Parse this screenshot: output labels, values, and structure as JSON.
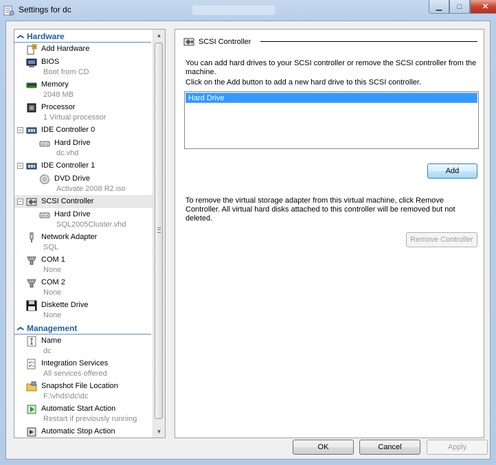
{
  "window": {
    "title": "Settings for dc",
    "close_glyph": "✕",
    "min_glyph": "▁",
    "max_glyph": "□"
  },
  "nav": {
    "sections": [
      {
        "title": "Hardware",
        "items": [
          {
            "key": "add-hardware",
            "label": "Add Hardware",
            "sub": "",
            "icon": "add-hardware-icon",
            "level": 0,
            "expander": ""
          },
          {
            "key": "bios",
            "label": "BIOS",
            "sub": "Boot from CD",
            "icon": "bios-icon",
            "level": 0,
            "expander": ""
          },
          {
            "key": "memory",
            "label": "Memory",
            "sub": "2048 MB",
            "icon": "memory-icon",
            "level": 0,
            "expander": ""
          },
          {
            "key": "processor",
            "label": "Processor",
            "sub": "1 Virtual processor",
            "icon": "processor-icon",
            "level": 0,
            "expander": ""
          },
          {
            "key": "ide-controller-0",
            "label": "IDE Controller 0",
            "sub": "",
            "icon": "ide-controller-icon",
            "level": 0,
            "expander": "−"
          },
          {
            "key": "ide0-hard-drive",
            "label": "Hard Drive",
            "sub": "dc.vhd",
            "icon": "hard-drive-icon",
            "level": 1,
            "expander": ""
          },
          {
            "key": "ide-controller-1",
            "label": "IDE Controller 1",
            "sub": "",
            "icon": "ide-controller-icon",
            "level": 0,
            "expander": "−"
          },
          {
            "key": "dvd-drive",
            "label": "DVD Drive",
            "sub": "Activate 2008 R2.iso",
            "icon": "dvd-drive-icon",
            "level": 1,
            "expander": ""
          },
          {
            "key": "scsi-controller",
            "label": "SCSI Controller",
            "sub": "",
            "icon": "scsi-controller-icon",
            "level": 0,
            "expander": "−",
            "selected": true
          },
          {
            "key": "scsi-hard-drive",
            "label": "Hard Drive",
            "sub": "SQL2005Cluster.vhd",
            "icon": "hard-drive-icon",
            "level": 1,
            "expander": ""
          },
          {
            "key": "network-adapter",
            "label": "Network Adapter",
            "sub": "SQL",
            "icon": "network-adapter-icon",
            "level": 0,
            "expander": ""
          },
          {
            "key": "com1",
            "label": "COM 1",
            "sub": "None",
            "icon": "com-port-icon",
            "level": 0,
            "expander": ""
          },
          {
            "key": "com2",
            "label": "COM 2",
            "sub": "None",
            "icon": "com-port-icon",
            "level": 0,
            "expander": ""
          },
          {
            "key": "diskette-drive",
            "label": "Diskette Drive",
            "sub": "None",
            "icon": "diskette-icon",
            "level": 0,
            "expander": ""
          }
        ]
      },
      {
        "title": "Management",
        "items": [
          {
            "key": "name",
            "label": "Name",
            "sub": "dc",
            "icon": "name-icon",
            "level": 0,
            "expander": ""
          },
          {
            "key": "integration-services",
            "label": "Integration Services",
            "sub": "All services offered",
            "icon": "integration-services-icon",
            "level": 0,
            "expander": ""
          },
          {
            "key": "snapshot-file-location",
            "label": "Snapshot File Location",
            "sub": "F:\\vhds\\dc\\dc",
            "icon": "snapshot-folder-icon",
            "level": 0,
            "expander": ""
          },
          {
            "key": "automatic-start-action",
            "label": "Automatic Start Action",
            "sub": "Restart if previously running",
            "icon": "start-action-icon",
            "level": 0,
            "expander": ""
          },
          {
            "key": "automatic-stop-action",
            "label": "Automatic Stop Action",
            "sub": "",
            "icon": "stop-action-icon",
            "level": 0,
            "expander": ""
          }
        ]
      }
    ],
    "collapse_glyph": "❮",
    "scroll_up_glyph": "▲",
    "scroll_down_glyph": "▼"
  },
  "detail": {
    "title": "SCSI Controller",
    "intro": "You can add hard drives to your SCSI controller or remove the SCSI controller from the machine.",
    "instruction": "Click on the Add button to add a new hard drive to this SCSI controller.",
    "drive_list": [
      "Hard Drive"
    ],
    "add_label": "Add",
    "remove_text": "To remove the virtual storage adapter from this virtual machine, click Remove Controller. All virtual hard disks attached to this controller will be removed but not deleted.",
    "remove_label": "Remove Controller"
  },
  "footer": {
    "ok_label": "OK",
    "cancel_label": "Cancel",
    "apply_label": "Apply"
  },
  "colors": {
    "selection": "#3399ff",
    "section_header": "#1f5fa8",
    "window_frame": "#b9d1ea"
  }
}
